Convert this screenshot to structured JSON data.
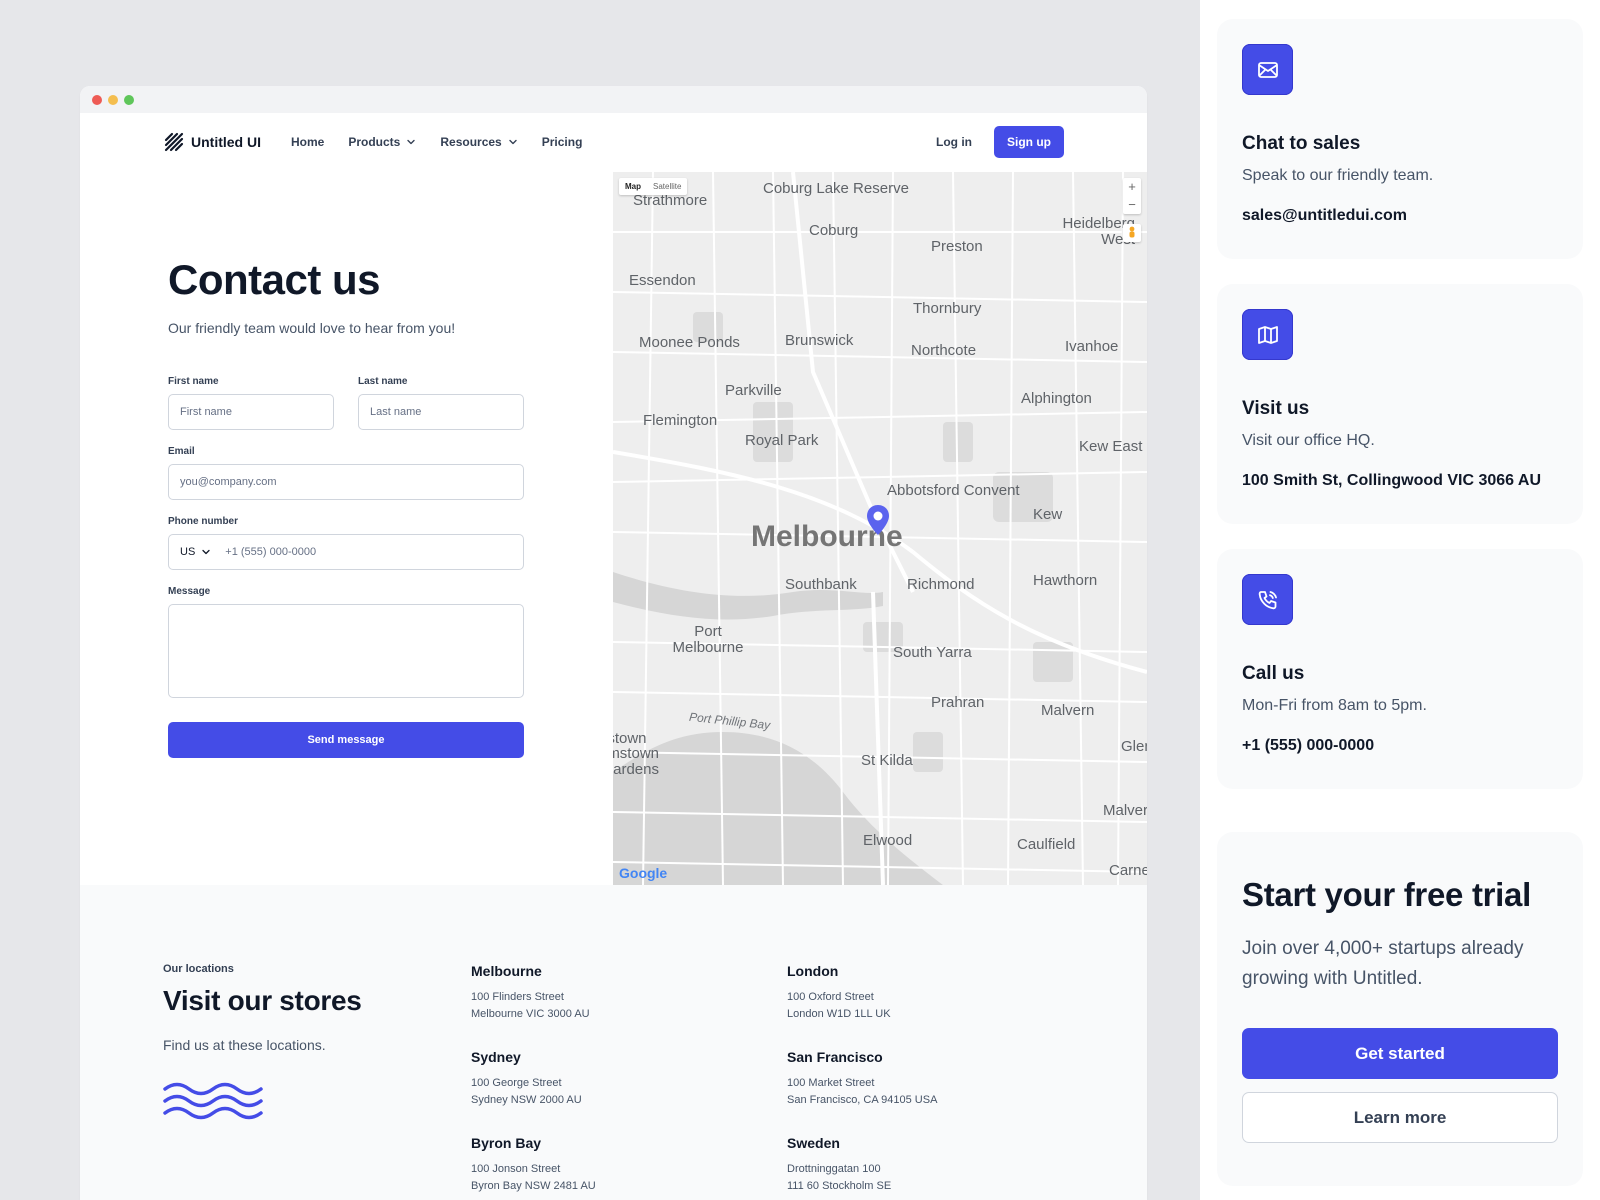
{
  "brand": {
    "name": "Untitled UI"
  },
  "nav": {
    "links": [
      "Home",
      "Products",
      "Resources",
      "Pricing"
    ],
    "login": "Log in",
    "signup": "Sign up"
  },
  "form": {
    "title": "Contact us",
    "subtitle": "Our friendly team would love to hear from you!",
    "first_name_label": "First name",
    "first_name_placeholder": "First name",
    "last_name_label": "Last name",
    "last_name_placeholder": "Last name",
    "email_label": "Email",
    "email_placeholder": "you@company.com",
    "phone_label": "Phone number",
    "phone_country": "US",
    "phone_placeholder": "+1 (555) 000-0000",
    "message_label": "Message",
    "submit": "Send message"
  },
  "map": {
    "toggle_map": "Map",
    "toggle_satellite": "Satellite",
    "zoom_in": "+",
    "zoom_out": "−",
    "attribution": "Google",
    "labels": [
      "Coburg Lake Reserve",
      "Strathmore",
      "Coburg",
      "Preston",
      "Heidelberg West",
      "Essendon",
      "Thornbury",
      "Moonee Ponds",
      "Brunswick",
      "Northcote",
      "Ivanhoe",
      "Parkville",
      "Alphington",
      "Flemington",
      "Royal Park",
      "Kew East",
      "Abbotsford Convent",
      "Kew",
      "Melbourne",
      "Southbank",
      "Richmond",
      "Hawthorn",
      "Port Melbourne",
      "South Yarra",
      "Prahran",
      "Malvern",
      "Port Phillip Bay",
      "St Kilda",
      "Elwood",
      "Caulfield",
      "Malvern",
      "Carnegie",
      "Glen Iris",
      "Williamstown",
      "Williamstown Gardens"
    ]
  },
  "locations": {
    "eyebrow": "Our locations",
    "title": "Visit our stores",
    "subtitle": "Find us at these locations.",
    "items": [
      {
        "city": "Melbourne",
        "line1": "100 Flinders Street",
        "line2": "Melbourne VIC 3000 AU"
      },
      {
        "city": "Sydney",
        "line1": "100 George Street",
        "line2": "Sydney NSW 2000 AU"
      },
      {
        "city": "Byron Bay",
        "line1": "100 Jonson Street",
        "line2": "Byron Bay NSW 2481 AU"
      },
      {
        "city": "London",
        "line1": "100 Oxford Street",
        "line2": "London W1D 1LL UK"
      },
      {
        "city": "San Francisco",
        "line1": "100 Market Street",
        "line2": "San Francisco, CA 94105 USA"
      },
      {
        "city": "Sweden",
        "line1": "Drottninggatan 100",
        "line2": "111 60 Stockholm SE"
      }
    ]
  },
  "cards": [
    {
      "icon": "mail-icon",
      "title": "Chat to sales",
      "subtitle": "Speak to our friendly team.",
      "link": "sales@untitledui.com"
    },
    {
      "icon": "map-icon",
      "title": "Visit us",
      "subtitle": "Visit our office HQ.",
      "link": "100 Smith St, Collingwood VIC 3066 AU"
    },
    {
      "icon": "phone-icon",
      "title": "Call us",
      "subtitle": "Mon-Fri from 8am to 5pm.",
      "link": "+1 (555) 000-0000"
    }
  ],
  "trial": {
    "title": "Start your free trial",
    "subtitle": "Join over 4,000+ startups already growing with Untitled.",
    "primary": "Get started",
    "secondary": "Learn more"
  },
  "colors": {
    "accent": "#444CE7",
    "text": "#101828",
    "muted": "#475467",
    "border": "#D0D5DD"
  }
}
